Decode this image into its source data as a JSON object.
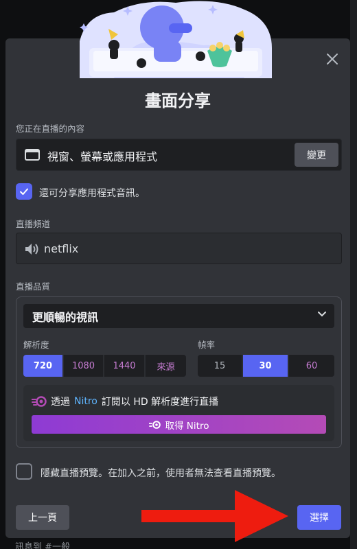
{
  "background": {
    "bottom_text": "訊息到 #一般"
  },
  "modal": {
    "title": "畫面分享",
    "source": {
      "label": "您正在直播的內容",
      "value": "視窗、螢幕或應用程式",
      "change_button": "變更"
    },
    "share_audio": {
      "label": "還可分享應用程式音訊。",
      "checked": true
    },
    "channel": {
      "label": "直播頻道",
      "value": "netflix",
      "icon": "speaker-icon"
    },
    "quality": {
      "label": "直播品質",
      "selected": "更順暢的視訊",
      "resolution": {
        "label": "解析度",
        "options": [
          "720",
          "1080",
          "1440",
          "來源"
        ],
        "selected": "720"
      },
      "framerate": {
        "label": "幀率",
        "options": [
          "15",
          "30",
          "60"
        ],
        "selected": "30"
      },
      "nitro_promo": {
        "text_prefix": "透過",
        "nitro_word": "Nitro",
        "text_suffix": "訂閱以 HD 解析度進行直播",
        "button": "取得 Nitro"
      }
    },
    "hide_preview": {
      "label": "隱藏直播預覽。在加入之前，使用者無法查看直播預覽。",
      "checked": false
    },
    "footer": {
      "back_button": "上一頁",
      "select_button": "選擇"
    }
  },
  "colors": {
    "accent": "#5865f2",
    "nitro": "#b44bb6",
    "background": "#313338",
    "arrow": "#ee1c0f"
  }
}
